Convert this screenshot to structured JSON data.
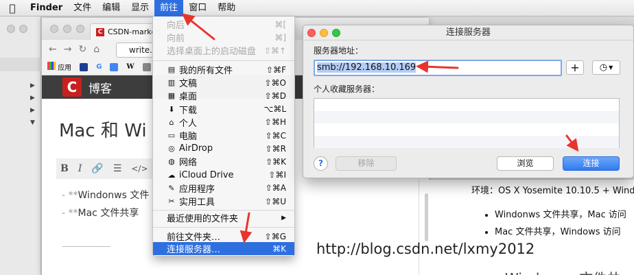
{
  "menubar": {
    "app": "Finder",
    "items": [
      "文件",
      "编辑",
      "显示",
      "前往",
      "窗口",
      "帮助"
    ],
    "active_index": 3
  },
  "go_menu": {
    "top_items": [
      {
        "label": "向后",
        "shortcut": "⌘[",
        "disabled": true
      },
      {
        "label": "向前",
        "shortcut": "⌘]",
        "disabled": true
      },
      {
        "label": "选择桌面上的启动磁盘",
        "shortcut": "⇧⌘↑",
        "disabled": true
      }
    ],
    "places": [
      {
        "label": "我的所有文件",
        "shortcut": "⇧⌘F",
        "icon": "all-files-icon",
        "glyph": "▤"
      },
      {
        "label": "文稿",
        "shortcut": "⇧⌘O",
        "icon": "documents-icon",
        "glyph": "▥"
      },
      {
        "label": "桌面",
        "shortcut": "⇧⌘D",
        "icon": "desktop-icon",
        "glyph": "▦"
      },
      {
        "label": "下载",
        "shortcut": "⌥⌘L",
        "icon": "downloads-icon",
        "glyph": "⬇"
      },
      {
        "label": "个人",
        "shortcut": "⇧⌘H",
        "icon": "home-icon",
        "glyph": "⌂"
      },
      {
        "label": "电脑",
        "shortcut": "⇧⌘C",
        "icon": "computer-icon",
        "glyph": "▭"
      },
      {
        "label": "AirDrop",
        "shortcut": "⇧⌘R",
        "icon": "airdrop-icon",
        "glyph": "◎"
      },
      {
        "label": "网络",
        "shortcut": "⇧⌘K",
        "icon": "network-icon",
        "glyph": "◍"
      },
      {
        "label": "iCloud Drive",
        "shortcut": "⇧⌘I",
        "icon": "icloud-icon",
        "glyph": "☁"
      },
      {
        "label": "应用程序",
        "shortcut": "⇧⌘A",
        "icon": "applications-icon",
        "glyph": "✎"
      },
      {
        "label": "实用工具",
        "shortcut": "⇧⌘U",
        "icon": "utilities-icon",
        "glyph": "✂"
      }
    ],
    "recent": {
      "label": "最近使用的文件夹",
      "submenu_glyph": "▶"
    },
    "goto_folder": {
      "label": "前往文件夹…",
      "shortcut": "⇧⌘G"
    },
    "connect_server": {
      "label": "连接服务器…",
      "shortcut": "⌘K"
    }
  },
  "browser": {
    "tab_title": "CSDN-markdo",
    "tab_logo": "C",
    "url": "write.",
    "bookmarks_label": "应用",
    "bookmark_letters": [
      "G",
      "W"
    ],
    "blog_logo": "C",
    "blog_title": "博客",
    "post_title": "Mac 和 Wi",
    "editor_buttons": {
      "bold": "B",
      "italic": "I",
      "code": "</>"
    },
    "md_lines": [
      {
        "prefix": "- **",
        "text": "Windonws 文件"
      },
      {
        "prefix": "- **",
        "text": "Mac 文件共享"
      }
    ],
    "md_rule": "-------------------"
  },
  "preview": {
    "env": "环境：OS X Yosemite 10.10.5 + Windo",
    "bullets": [
      "Windonws 文件共享，Mac 访问",
      "Mac 文件共享，Windows 访问"
    ],
    "heading": "Windonws 文件共"
  },
  "watermark": "http://blog.csdn.net/lxmy2012",
  "dialog": {
    "title": "连接服务器",
    "server_label": "服务器地址：",
    "server_value": "smb://192.168.10.169",
    "plus_label": "+",
    "recent_glyph": "◷",
    "favorites_label": "个人收藏服务器：",
    "help_label": "?",
    "remove_label": "移除",
    "browse_label": "浏览",
    "connect_label": "连接"
  },
  "colors": {
    "selection": "#2e6fe0",
    "annotation": "#e8352b",
    "blog_red": "#c9201f"
  }
}
